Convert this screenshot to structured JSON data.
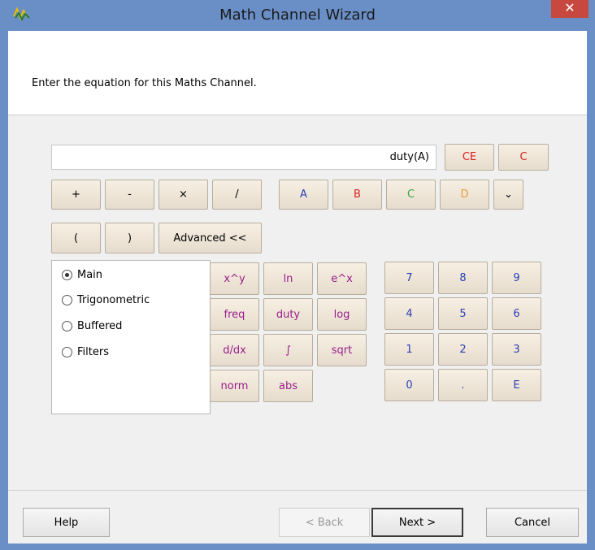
{
  "window": {
    "title": "Math Channel Wizard",
    "close_glyph": "✕"
  },
  "header": {
    "instruction": "Enter the equation for this Maths Channel."
  },
  "display": {
    "value": "duty(A)"
  },
  "clear_buttons": {
    "ce": "CE",
    "c": "C"
  },
  "operators": {
    "plus": "+",
    "minus": "-",
    "times": "×",
    "divide": "/"
  },
  "channels": {
    "a": "A",
    "b": "B",
    "c": "C",
    "d": "D",
    "more": "⌄"
  },
  "parens": {
    "open": "(",
    "close": ")"
  },
  "advanced_label": "Advanced <<",
  "categories": {
    "main": "Main",
    "trig": "Trigonometric",
    "buffered": "Buffered",
    "filters": "Filters",
    "selected": "Main"
  },
  "functions": {
    "power": "x^y",
    "ln": "ln",
    "exp": "e^x",
    "freq": "freq",
    "duty": "duty",
    "log": "log",
    "ddx": "d/dx",
    "integral": "∫",
    "sqrt": "sqrt",
    "norm": "norm",
    "abs": "abs"
  },
  "keypad": {
    "k7": "7",
    "k8": "8",
    "k9": "9",
    "k4": "4",
    "k5": "5",
    "k6": "6",
    "k1": "1",
    "k2": "2",
    "k3": "3",
    "k0": "0",
    "dot": ".",
    "exp": "E"
  },
  "footer": {
    "help": "Help",
    "back": "< Back",
    "next": "Next >",
    "cancel": "Cancel"
  },
  "colors": {
    "titlebar": "#6a8fc7",
    "close": "#c7483f",
    "channel_a": "#2c3fb6",
    "channel_b": "#d62020",
    "channel_c": "#3aa845",
    "channel_d": "#e3a13a",
    "function_text": "#9a1d8a",
    "keypad_text": "#2c3fb6"
  }
}
